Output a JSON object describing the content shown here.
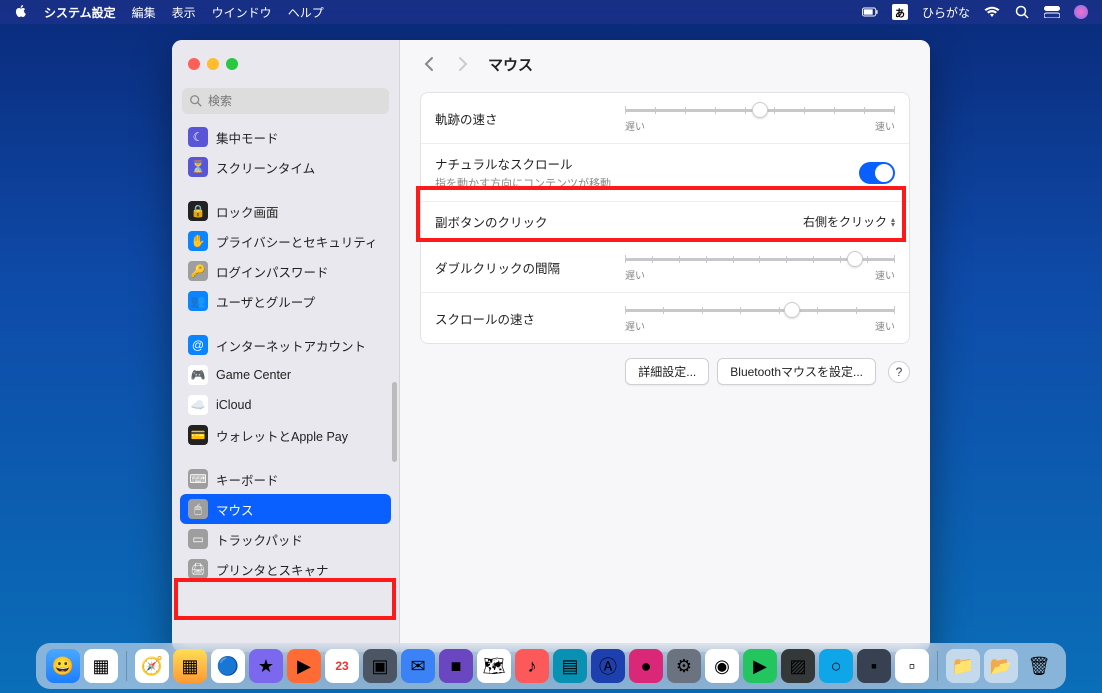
{
  "menubar": {
    "app": "システム設定",
    "items": [
      "編集",
      "表示",
      "ウインドウ",
      "ヘルプ"
    ],
    "ime_indicator": "あ",
    "ime_label": "ひらがな"
  },
  "search": {
    "placeholder": "検索"
  },
  "sidebar": {
    "items": [
      {
        "label": "集中モード",
        "icon_bg": "#5856d6",
        "glyph": "☾"
      },
      {
        "label": "スクリーンタイム",
        "icon_bg": "#5856d6",
        "glyph": "⏳"
      },
      {
        "label": "ロック画面",
        "icon_bg": "#222",
        "glyph": "🔒",
        "gap_before": true
      },
      {
        "label": "プライバシーとセキュリティ",
        "icon_bg": "#0a84ff",
        "glyph": "✋"
      },
      {
        "label": "ログインパスワード",
        "icon_bg": "#9e9e9e",
        "glyph": "🔑"
      },
      {
        "label": "ユーザとグループ",
        "icon_bg": "#0a84ff",
        "glyph": "👥"
      },
      {
        "label": "インターネットアカウント",
        "icon_bg": "#0a84ff",
        "glyph": "@",
        "gap_before": true
      },
      {
        "label": "Game Center",
        "icon_bg": "#fff",
        "glyph": "🎮"
      },
      {
        "label": "iCloud",
        "icon_bg": "#fff",
        "glyph": "☁️"
      },
      {
        "label": "ウォレットとApple Pay",
        "icon_bg": "#222",
        "glyph": "💳"
      },
      {
        "label": "キーボード",
        "icon_bg": "#9e9e9e",
        "glyph": "⌨",
        "gap_before": true
      },
      {
        "label": "マウス",
        "icon_bg": "#9e9e9e",
        "glyph": "🖱",
        "selected": true
      },
      {
        "label": "トラックパッド",
        "icon_bg": "#9e9e9e",
        "glyph": "▭"
      },
      {
        "label": "プリンタとスキャナ",
        "icon_bg": "#9e9e9e",
        "glyph": "🖨"
      }
    ]
  },
  "main": {
    "title": "マウス",
    "tracking": {
      "label": "軌跡の速さ",
      "min_label": "遅い",
      "max_label": "速い",
      "value_pct": 50
    },
    "natural_scroll": {
      "label": "ナチュラルなスクロール",
      "sub": "指を動かす方向にコンテンツが移動",
      "enabled": true
    },
    "secondary_click": {
      "label": "副ボタンのクリック",
      "value": "右側をクリック"
    },
    "double_click": {
      "label": "ダブルクリックの間隔",
      "min_label": "遅い",
      "max_label": "速い",
      "value_pct": 85
    },
    "scroll_speed": {
      "label": "スクロールの速さ",
      "min_label": "遅い",
      "max_label": "速い",
      "value_pct": 62
    },
    "buttons": {
      "advanced": "詳細設定...",
      "bluetooth": "Bluetoothマウスを設定...",
      "help": "?"
    }
  },
  "dock": {
    "date_badge": "23"
  }
}
